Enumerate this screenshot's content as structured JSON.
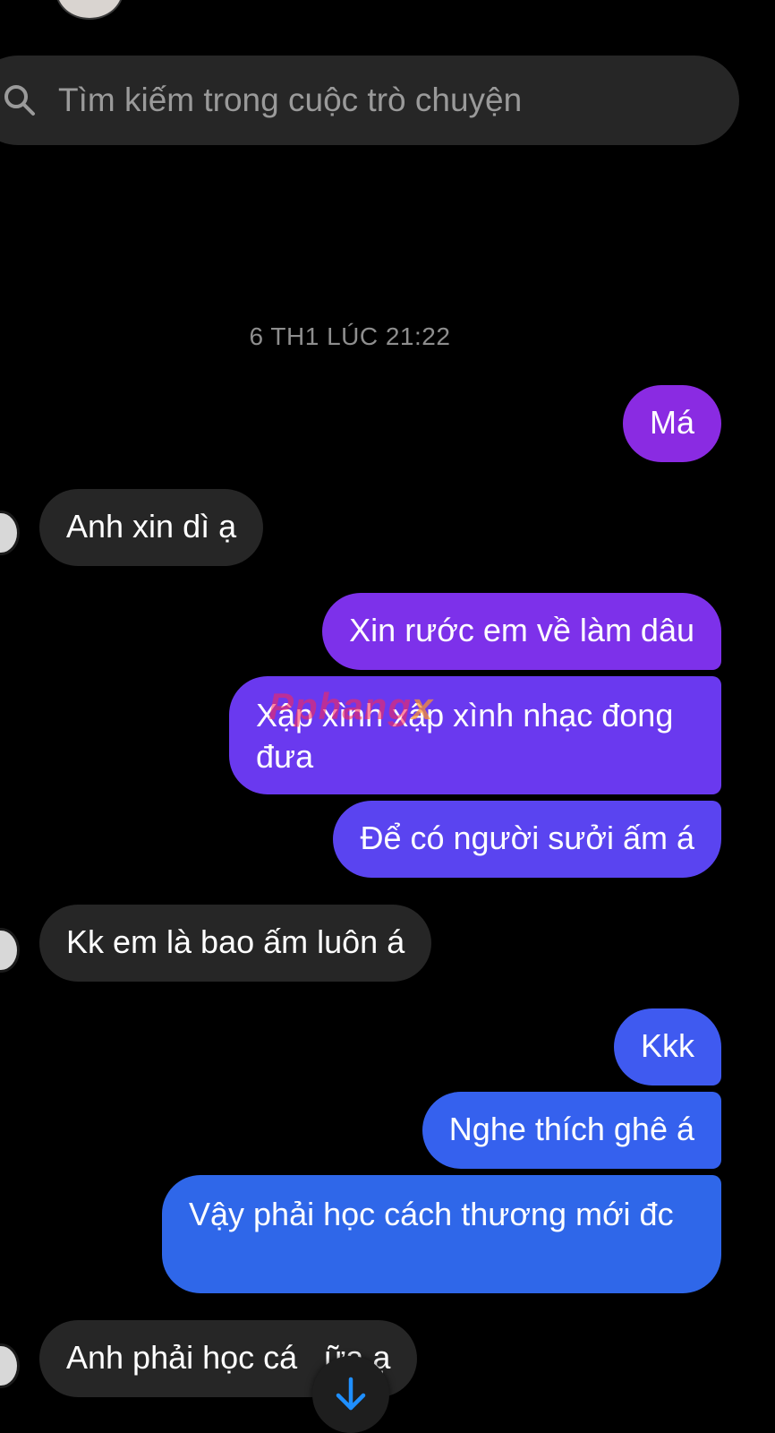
{
  "search": {
    "placeholder": "Tìm kiếm trong cuộc trò chuyện"
  },
  "timestamp": "6 TH1 LÚC 21:22",
  "watermark": {
    "text": "Pphang",
    "suffix": "x"
  },
  "messages": [
    {
      "from": "me",
      "text": "Má"
    },
    {
      "from": "them",
      "text": "Anh xin dì ạ"
    },
    {
      "from": "me",
      "text": "Xin rước em về làm dâu"
    },
    {
      "from": "me",
      "text": "Xập xình xập xình nhạc đong đưa"
    },
    {
      "from": "me",
      "text": "Để có người sưởi ấm á"
    },
    {
      "from": "them",
      "text": "Kk em là bao ấm luôn á"
    },
    {
      "from": "me",
      "text": "Kkk"
    },
    {
      "from": "me",
      "text": "Nghe thích ghê á"
    },
    {
      "from": "me",
      "text": "Vậy phải học cách thương mới đc"
    },
    {
      "from": "them",
      "text": "Anh phải học cá   ữa ạ"
    }
  ],
  "colors": {
    "background": "#000000",
    "incoming_bubble": "#262626",
    "outgoing_gradient": [
      "#8a2be2",
      "#6f36f0",
      "#4b57f0",
      "#2e66e8"
    ],
    "scroll_button_arrow": "#1f8fff"
  },
  "icons": {
    "search": "search-icon",
    "scroll_down": "arrow-down-icon"
  }
}
